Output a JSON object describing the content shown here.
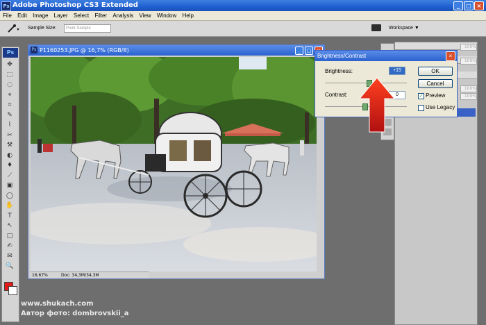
{
  "app": {
    "title": "Adobe Photoshop CS3 Extended",
    "minimize": "_",
    "maximize": "□",
    "close": "×"
  },
  "menu": [
    "File",
    "Edit",
    "Image",
    "Layer",
    "Select",
    "Filter",
    "Analysis",
    "View",
    "Window",
    "Help"
  ],
  "options_bar": {
    "tool_icon": "eyedropper-icon",
    "sample_size_label": "Sample Size:",
    "sample_size_value": "Point Sample",
    "workspace_label": "Workspace ▼"
  },
  "toolbox": {
    "logo": "Ps",
    "tool_glyphs": [
      "✥",
      "⬚",
      "◌",
      "⌖",
      "⌗",
      "✎",
      "⌇",
      "✂",
      "⚒",
      "◐",
      "♦",
      "⟋",
      "▣",
      "◯",
      "✋",
      "T",
      "↖",
      "□",
      "✍",
      "✉",
      "🔍"
    ],
    "foreground_color": "#e21a1a",
    "background_color": "#ffffff"
  },
  "document": {
    "title": "P1160253.JPG @ 16,7% (RGB/8)",
    "zoom": "16,67%",
    "doc_info": "Doc: 34,3M/34,3M"
  },
  "dialog": {
    "title": "Brightness/Contrast",
    "brightness_label": "Brightness:",
    "brightness_value": "+15",
    "contrast_label": "Contrast:",
    "contrast_value": "0",
    "ok_label": "OK",
    "cancel_label": "Cancel",
    "preview_label": "Preview",
    "preview_checked": true,
    "legacy_label": "Use Legacy",
    "legacy_checked": false
  },
  "right_panel": {
    "percent_values": [
      "100%",
      "100%",
      "100%",
      "100%"
    ]
  },
  "watermark": {
    "line1": "www.shukach.com",
    "line2": "Автор фото: dombrovskii_a"
  }
}
